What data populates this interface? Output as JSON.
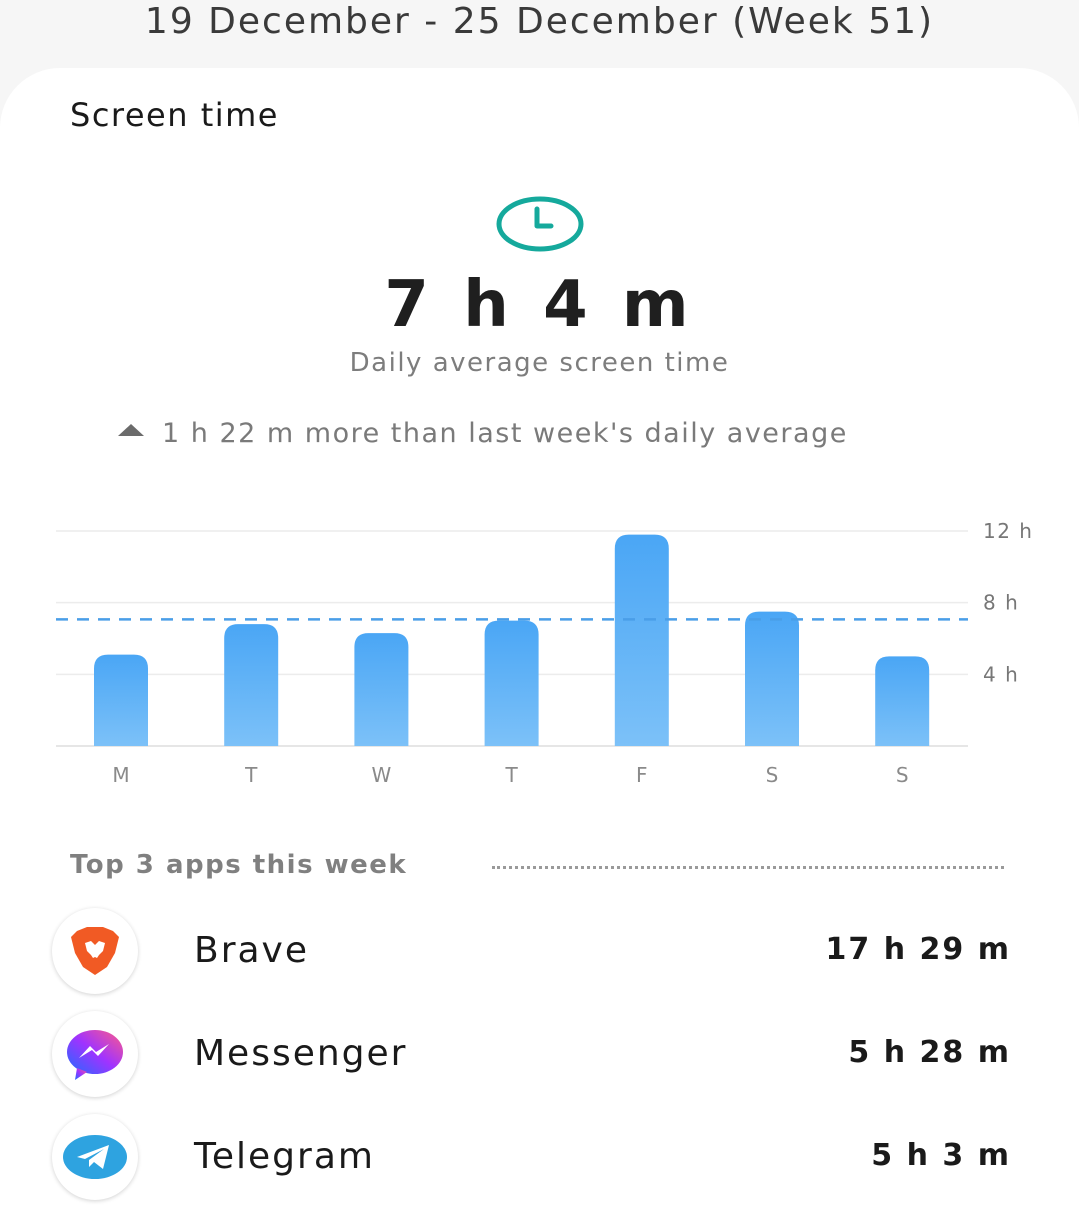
{
  "header": {
    "week_range": "19 December - 25 December (Week 51)"
  },
  "card": {
    "title": "Screen time",
    "icon": "clock-icon",
    "total_time": "7 h 4 m",
    "avg_label": "Daily average screen time",
    "comparison": {
      "icon": "triangle-up-icon",
      "text": "1 h 22 m more than last week's daily average"
    }
  },
  "chart_data": {
    "type": "bar",
    "categories": [
      "M",
      "T",
      "W",
      "T",
      "F",
      "S",
      "S"
    ],
    "values": [
      5.1,
      6.8,
      6.3,
      7.0,
      11.8,
      7.5,
      5.0
    ],
    "average_line": 7.07,
    "ylim": [
      0,
      12
    ],
    "yticks": [
      4,
      8,
      12
    ],
    "ytick_labels": [
      "4 h",
      "8 h",
      "12 h"
    ],
    "grid": true,
    "bar_color": "#4aa6f5",
    "average_line_color": "#4a9ee8"
  },
  "top_apps": {
    "label": "Top 3 apps this week",
    "items": [
      {
        "name": "Brave",
        "time": "17 h 29 m",
        "icon": "brave-lion-icon"
      },
      {
        "name": "Messenger",
        "time": "5 h 28 m",
        "icon": "messenger-bolt-icon"
      },
      {
        "name": "Telegram",
        "time": "5 h 3 m",
        "icon": "telegram-plane-icon"
      }
    ]
  },
  "colors": {
    "accent_teal": "#15a99c",
    "bar_blue": "#4aa6f5"
  }
}
